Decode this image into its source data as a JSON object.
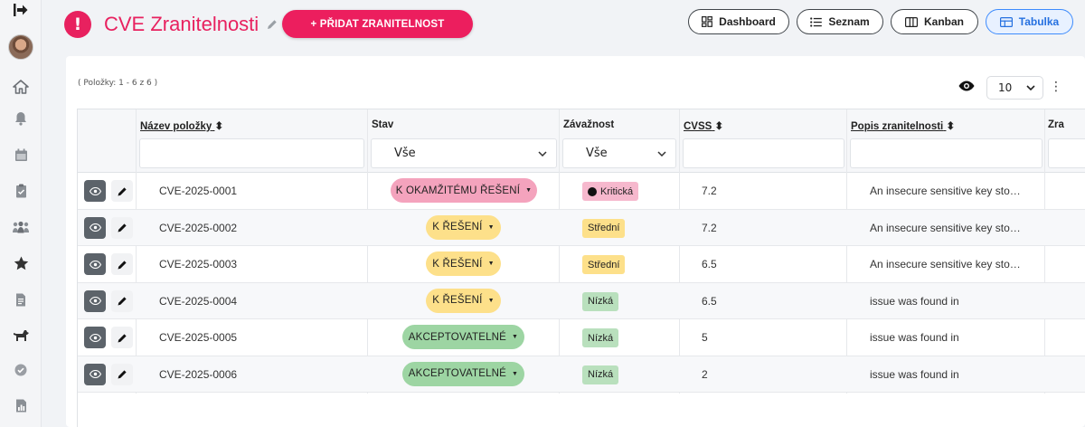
{
  "header": {
    "title": "CVE Zranitelnosti",
    "add_button": "+ PŘIDAT ZRANITELNOST"
  },
  "views": [
    {
      "label": "Dashboard",
      "icon": "dashboard-icon"
    },
    {
      "label": "Seznam",
      "icon": "list-icon"
    },
    {
      "label": "Kanban",
      "icon": "kanban-icon"
    },
    {
      "label": "Tabulka",
      "icon": "table-icon",
      "active": true
    }
  ],
  "sidebar": [
    "logout-icon",
    "avatar",
    "home-icon",
    "bell-icon",
    "calendar-icon",
    "clipboard-icon",
    "users-icon",
    "star-icon",
    "document-icon",
    "dog-icon",
    "check-circle-icon",
    "report-icon"
  ],
  "table": {
    "items_count": "( Položky: 1 - 6 z 6 )",
    "page_size": "10",
    "columns": {
      "name": "Název položky",
      "status": "Stav",
      "severity": "Závažnost",
      "cvss": "CVSS",
      "description": "Popis zranitelnosti",
      "extra": "Zra"
    },
    "filters": {
      "status": "Vše",
      "severity": "Vše"
    },
    "rows": [
      {
        "name": "CVE-2025-0001",
        "status": "K OKAMŽITÉMU ŘEŠENÍ",
        "severity": "Kritická",
        "cvss": "7.2",
        "description": "An insecure sensitive key sto…"
      },
      {
        "name": "CVE-2025-0002",
        "status": "K ŘEŠENÍ",
        "severity": "Střední",
        "cvss": "7.2",
        "description": "An insecure sensitive key sto…"
      },
      {
        "name": "CVE-2025-0003",
        "status": "K ŘEŠENÍ",
        "severity": "Střední",
        "cvss": "6.5",
        "description": "An insecure sensitive key sto…"
      },
      {
        "name": "CVE-2025-0004",
        "status": "K ŘEŠENÍ",
        "severity": "Nízká",
        "cvss": "6.5",
        "description": "issue was found in"
      },
      {
        "name": "CVE-2025-0005",
        "status": "AKCEPTOVATELNÉ",
        "severity": "Nízká",
        "cvss": "5",
        "description": "issue was found in"
      },
      {
        "name": "CVE-2025-0006",
        "status": "AKCEPTOVATELNÉ",
        "severity": "Nízká",
        "cvss": "2",
        "description": "issue was found in"
      }
    ]
  },
  "colors": {
    "brand": "#e8215f",
    "status_urgent": "#f4a3bd",
    "status_todo": "#fde08a",
    "status_accept": "#9dd5a3",
    "sev_critical": "#f6b8cd",
    "sev_medium": "#fde08a",
    "sev_low": "#b9e0bd",
    "active_view": "#3d8bfd"
  }
}
